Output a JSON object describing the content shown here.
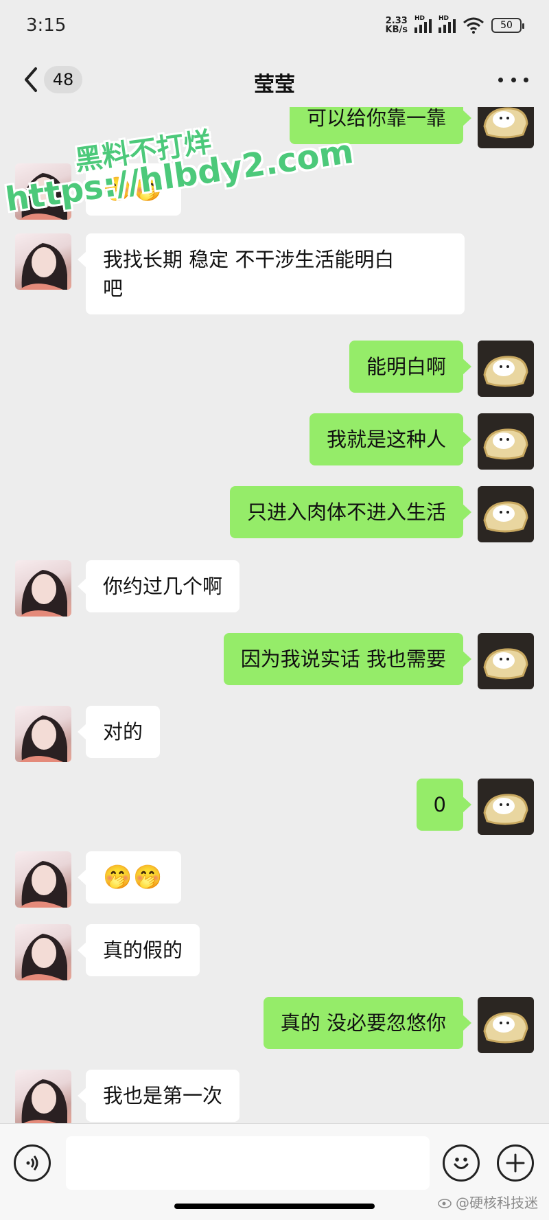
{
  "status_bar": {
    "time": "3:15",
    "net_speed_value": "2.33",
    "net_speed_unit": "KB/s",
    "signal_label_1": "HD",
    "signal_label_2": "HD",
    "battery": "50"
  },
  "header": {
    "unread_count": "48",
    "title": "莹莹"
  },
  "watermark": {
    "line1": "黑料不打烊",
    "line2": "https://hlbdy2.com"
  },
  "messages": [
    {
      "side": "out",
      "text": "可以给你靠一靠"
    },
    {
      "side": "in",
      "text": "🤭🤭"
    },
    {
      "side": "in",
      "text": "我找长期 稳定 不干涉生活能明白\n吧"
    },
    {
      "side": "out",
      "text": "能明白啊"
    },
    {
      "side": "out",
      "text": "我就是这种人"
    },
    {
      "side": "out",
      "text": "只进入肉体不进入生活"
    },
    {
      "side": "in",
      "text": "你约过几个啊"
    },
    {
      "side": "out",
      "text": "因为我说实话 我也需要"
    },
    {
      "side": "in",
      "text": "对的"
    },
    {
      "side": "out",
      "text": "0"
    },
    {
      "side": "in",
      "text": "🤭🤭"
    },
    {
      "side": "in",
      "text": "真的假的"
    },
    {
      "side": "out",
      "text": "真的 没必要忽悠你"
    },
    {
      "side": "in",
      "text": "我也是第一次"
    }
  ],
  "input_bar": {
    "placeholder": ""
  },
  "source_credit": "@硬核科技迷",
  "colors": {
    "background": "#ededed",
    "outgoing_bubble": "#95ec69",
    "incoming_bubble": "#ffffff",
    "watermark": "#4cc97a"
  }
}
